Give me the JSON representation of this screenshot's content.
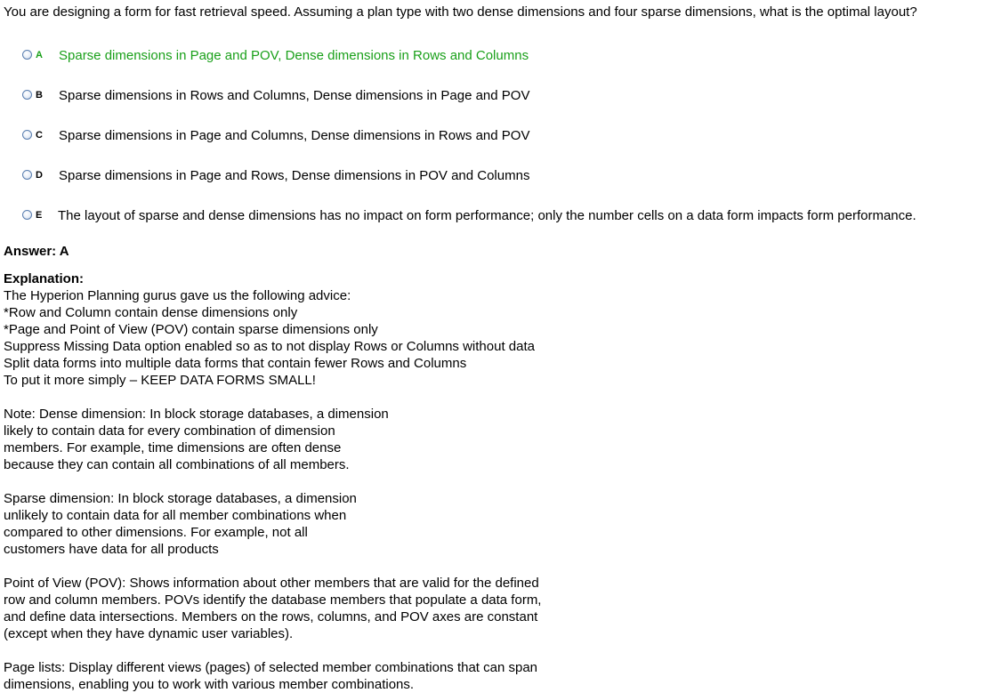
{
  "question": "You are designing a form for fast retrieval speed. Assuming a plan type with two dense dimensions and four sparse dimensions, what is the optimal layout?",
  "options": [
    {
      "letter": "A",
      "text": "Sparse dimensions in Page and POV, Dense dimensions in Rows and Columns",
      "correct": true
    },
    {
      "letter": "B",
      "text": "Sparse dimensions in Rows and Columns, Dense dimensions in Page and POV",
      "correct": false
    },
    {
      "letter": "C",
      "text": "Sparse dimensions in Page and Columns, Dense dimensions in Rows and POV",
      "correct": false
    },
    {
      "letter": "D",
      "text": "Sparse dimensions in Page and Rows, Dense dimensions in POV and Columns",
      "correct": false
    },
    {
      "letter": "E",
      "text": "The layout of sparse and dense dimensions has no impact on form performance; only the number cells on a data form impacts form performance.",
      "correct": false
    }
  ],
  "answer": "Answer: A",
  "explanation": {
    "title": "Explanation:",
    "lines": [
      "The Hyperion Planning gurus gave us the following advice:",
      "*Row and Column contain dense dimensions only",
      "*Page and Point of View (POV) contain sparse dimensions only",
      "Suppress Missing Data option enabled so as to not display Rows or Columns without data",
      "Split data forms into multiple data forms that contain fewer Rows and Columns",
      "To put it more simply – KEEP DATA FORMS SMALL!",
      "",
      "Note: Dense dimension: In block storage databases, a dimension",
      "likely to contain data for every combination of dimension",
      "members. For example, time dimensions are often dense",
      "because they can contain all combinations of all members.",
      "",
      "Sparse dimension: In block storage databases, a dimension",
      "unlikely to contain data for all member combinations when",
      "compared to other dimensions. For example, not all",
      "customers have data for all products",
      "",
      "Point of View (POV): Shows information about other members that are valid for the defined",
      "row and column members. POVs identify the database members that populate a data form,",
      "and define data intersections. Members on the rows, columns, and POV axes are constant",
      "(except when they have dynamic user variables).",
      "",
      "Page lists: Display different views (pages) of selected member combinations that can span",
      "dimensions, enabling you to work with various member combinations."
    ]
  },
  "colors": {
    "correct": "#1aa01a",
    "text": "#000000",
    "radio_border": "#5a7fb0"
  }
}
